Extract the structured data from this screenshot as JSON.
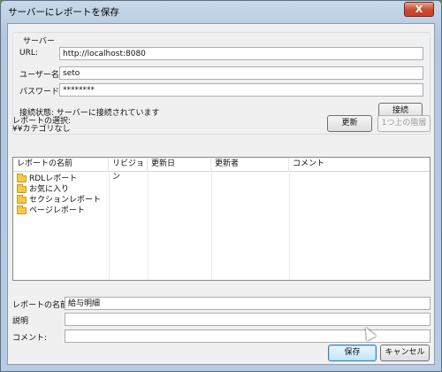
{
  "window": {
    "title": "サーバーにレポートを保存",
    "close_glyph": "X"
  },
  "server": {
    "group_title": "サーバー",
    "url_label": "URL:",
    "url_value": "http://localhost:8080",
    "user_label": "ユーザー名:",
    "user_value": "seto",
    "password_label": "パスワード:",
    "password_value": "********",
    "status_label": "接続状態: サーバーに接続されています",
    "connect_button": "接続"
  },
  "selection": {
    "label_line1": "レポートの選択:",
    "label_line2": "¥¥カテゴリなし",
    "refresh_button": "更新",
    "up_button": "1つ上の階層"
  },
  "report_list": {
    "columns": [
      "レポートの名前",
      "リビジョン",
      "更新日",
      "更新者",
      "コメント"
    ],
    "items": [
      {
        "name": "RDLレポート",
        "icon": "folder-icon"
      },
      {
        "name": "お気に入り",
        "icon": "folder-icon"
      },
      {
        "name": "セクションレポート",
        "icon": "folder-icon"
      },
      {
        "name": "ページレポート",
        "icon": "folder-icon"
      }
    ]
  },
  "form": {
    "name_label": "レポートの名前:",
    "name_value": "給与明細",
    "description_label": "説明",
    "description_value": "",
    "comment_label": "コメント:",
    "comment_value": ""
  },
  "footer": {
    "save_button": "保存",
    "cancel_button": "キャンセル"
  },
  "colors": {
    "titlebar": "#c9d9ea",
    "close": "#c74a30",
    "folder": "#f1c94d"
  }
}
